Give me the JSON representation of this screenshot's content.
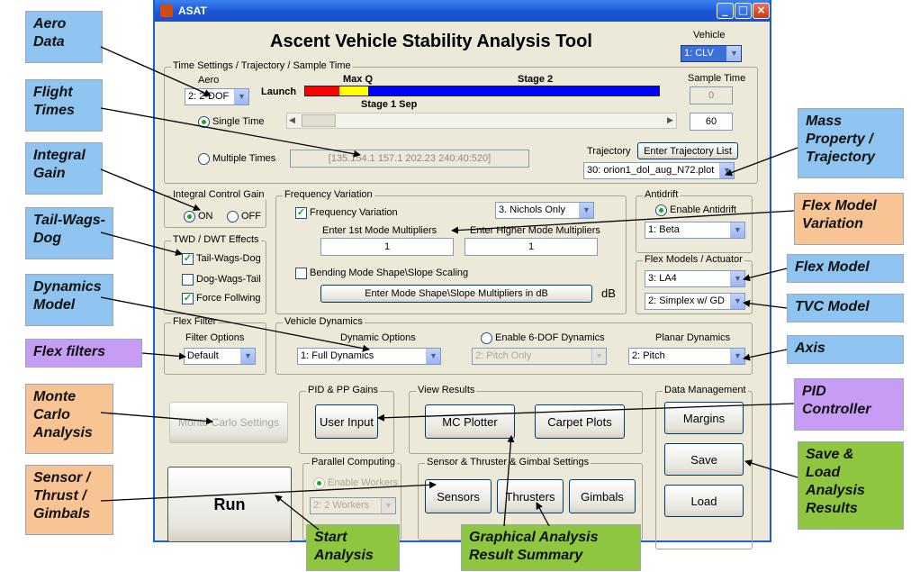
{
  "window": {
    "title": "ASAT",
    "heading": "Ascent Vehicle Stability Analysis Tool"
  },
  "vehicle": {
    "label": "Vehicle",
    "value": "1: CLV"
  },
  "time": {
    "group_label": "Time Settings / Trajectory / Sample Time",
    "aero_label": "Aero",
    "aero_value": "2: 2-DOF",
    "launch_label": "Launch",
    "maxq_label": "Max Q",
    "stage2_label": "Stage 2",
    "stage1sep_label": "Stage 1 Sep",
    "single_time": "Single Time",
    "multiple_times": "Multiple Times",
    "multiple_times_value": "[135.154.1 157.1 202.23 240:40:520]",
    "sample_time_label": "Sample Time",
    "sample_time_value": "0",
    "time_value": "60",
    "trajectory_label": "Trajectory",
    "trajectory_button": "Enter Trajectory List",
    "trajectory_value": "30: orion1_dol_aug_N72.plot"
  },
  "integral": {
    "group_label": "Integral Control Gain",
    "on": "ON",
    "off": "OFF"
  },
  "twd": {
    "group_label": "TWD / DWT Effects",
    "tail_wags_dog": "Tail-Wags-Dog",
    "dog_wags_tail": "Dog-Wags-Tail",
    "force_following": "Force Follwing"
  },
  "freq": {
    "group_label": "Frequency Variation",
    "checkbox_label": "Frequency Variation",
    "nichols_value": "3. Nichols Only",
    "first_mode_label": "Enter 1st Mode Multipliers",
    "first_mode_value": "1",
    "higher_mode_label": "Enter Higher Mode Multipliers",
    "higher_mode_value": "1",
    "bending_label": "Bending Mode Shape\\Slope Scaling",
    "mode_shape_button": "Enter Mode Shape\\Slope Multipliers in dB",
    "db_label": "dB"
  },
  "antidrift": {
    "group_label": "Antidrift",
    "enable_label": "Enable Antidrift",
    "value": "1: Beta"
  },
  "flex_models": {
    "group_label": "Flex Models / Actuator",
    "model_value": "3: LA4",
    "actuator_value": "2: Simplex w/ GD"
  },
  "flex_filter": {
    "group_label": "Flex Filter",
    "options_label": "Filter Options",
    "value": "Default"
  },
  "dynamics": {
    "group_label": "Vehicle Dynamics",
    "options_label": "Dynamic Options",
    "options_value": "1: Full Dynamics",
    "six_dof_label": "Enable 6-DOF Dynamics",
    "six_dof_value": "2: Pitch Only",
    "planar_label": "Planar Dynamics",
    "planar_value": "2: Pitch"
  },
  "monte_carlo_button": "Monte Carlo Settings",
  "pid": {
    "group_label": "PID & PP Gains",
    "button": "User Input"
  },
  "view": {
    "group_label": "View Results",
    "mc_plotter": "MC Plotter",
    "carpet_plots": "Carpet Plots"
  },
  "data_mgmt": {
    "group_label": "Data Management",
    "margins": "Margins",
    "save": "Save",
    "load": "Load"
  },
  "run_button": "Run",
  "parallel": {
    "group_label": "Parallel Computing",
    "enable_label": "Enable Workers",
    "workers_value": "2: 2 Workers"
  },
  "sensor": {
    "group_label": "Sensor & Thruster & Gimbal Settings",
    "sensors": "Sensors",
    "thrusters": "Thrusters",
    "gimbals": "Gimbals"
  },
  "callouts": {
    "aero_data": "Aero\nData",
    "flight_times": "Flight\nTimes",
    "integral_gain": "Integral\nGain",
    "tail_wags_dog": "Tail-Wags-\nDog",
    "dynamics_model": "Dynamics\nModel",
    "flex_filters": "Flex filters",
    "monte_carlo": "Monte\nCarlo\nAnalysis",
    "sensor_thrust": "Sensor /\nThrust /\nGimbals",
    "mass_property": "Mass\nProperty /\nTrajectory",
    "flex_model_variation": "Flex Model\nVariation",
    "flex_model": "Flex Model",
    "tvc_model": "TVC Model",
    "axis": "Axis",
    "pid_controller": "PID\nController",
    "save_load": "Save &\nLoad\nAnalysis\nResults",
    "start_analysis": "Start\nAnalysis",
    "graphical_summary": "Graphical Analysis\nResult Summary"
  },
  "colors": {
    "blue_callout": "#8ec4ef",
    "orange_callout": "#f8c493",
    "purple_callout": "#c69cf4",
    "green_callout": "#8ec63f",
    "timeline_red": "#ff0000",
    "timeline_yellow": "#ffff00",
    "timeline_blue": "#0000ff",
    "radio_green": "#21a121"
  }
}
